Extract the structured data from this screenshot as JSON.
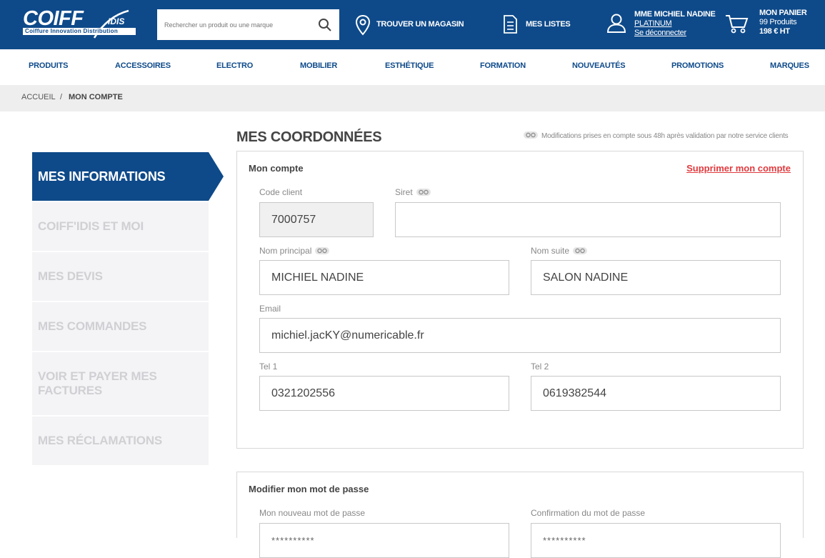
{
  "header": {
    "logo_main": "COIFF",
    "logo_suffix": "IDIS",
    "logo_tagline": "Coiffure Innovation Distribution",
    "search_placeholder": "Rechercher un produit ou une marque",
    "store_label": "TROUVER UN MAGASIN",
    "lists_label": "MES LISTES",
    "account": {
      "name": "MME MICHIEL NADINE",
      "tier": "PLATINUM",
      "logout": "Se déconnecter"
    },
    "cart": {
      "title": "MON PANIER",
      "count": "99 Produits",
      "total": "198 € HT"
    },
    "brand_color": "#0e4a8a"
  },
  "nav": {
    "items": [
      "PRODUITS",
      "ACCESSOIRES",
      "ELECTRO",
      "MOBILIER",
      "ESTHÉTIQUE",
      "FORMATION",
      "NOUVEAUTÉS",
      "PROMOTIONS",
      "MARQUES"
    ]
  },
  "breadcrumb": {
    "home": "ACCUEIL",
    "separator": "/",
    "current": "MON COMPTE"
  },
  "sidebar": {
    "active": "MES INFORMATIONS",
    "items": [
      "COIFF'IDIS ET MOI",
      "MES DEVIS",
      "MES COMMANDES",
      "VOIR ET PAYER MES FACTURES",
      "MES RÉCLAMATIONS"
    ]
  },
  "main": {
    "title": "MES COORDONNÉES",
    "notice": "Modifications prises en compte sous 48h après validation par notre service clients"
  },
  "account_panel": {
    "title": "Mon compte",
    "delete_link": "Supprimer mon compte",
    "fields": {
      "code_client": {
        "label": "Code client",
        "value": "7000757"
      },
      "siret": {
        "label": "Siret",
        "value": ""
      },
      "nom_principal": {
        "label": "Nom principal",
        "value": "MICHIEL NADINE"
      },
      "nom_suite": {
        "label": "Nom suite",
        "value": "SALON NADINE"
      },
      "email": {
        "label": "Email",
        "value": "michiel.jacKY@numericable.fr"
      },
      "tel1": {
        "label": "Tel 1",
        "value": "0321202556"
      },
      "tel2": {
        "label": "Tel 2",
        "value": "0619382544"
      }
    }
  },
  "password_panel": {
    "title": "Modifier mon mot de passe",
    "new_label": "Mon nouveau mot de passe",
    "confirm_label": "Confirmation du mot de passe",
    "new_value": "**********",
    "confirm_value": "**********"
  },
  "colors": {
    "accent": "#0e4a8a",
    "danger": "#e03a3e"
  }
}
